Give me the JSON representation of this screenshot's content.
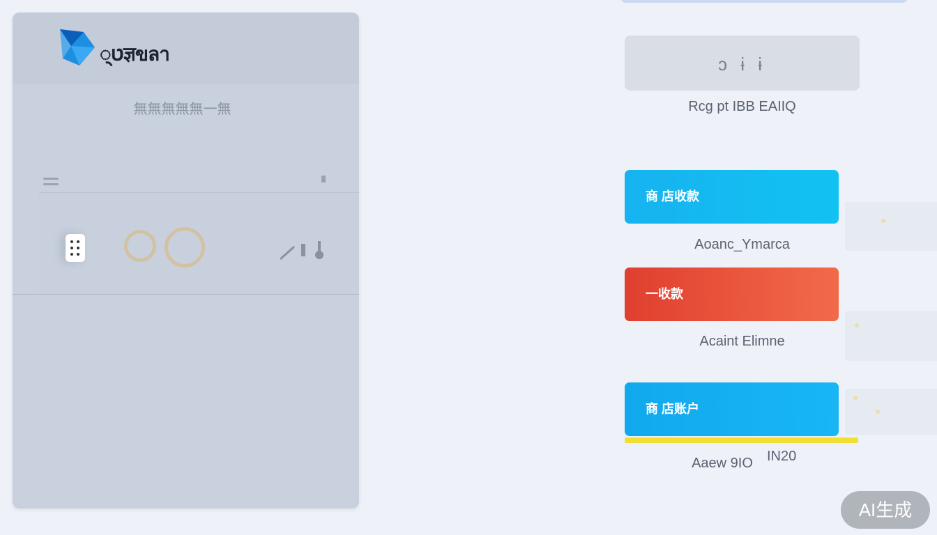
{
  "header": {
    "brand_name": "ט्ज्ञขลา",
    "subtitle": "無無無無無一無"
  },
  "display": {
    "value": "ɔ ɨ ɨ"
  },
  "captions": {
    "under_display": "Rcg pt IBB EAIIQ",
    "under_button_1": "Aoanc_Ymarca",
    "under_button_2": "Acaint Elimne",
    "under_button_3": "Aaew 9IO",
    "extra_value": "IN20"
  },
  "buttons": {
    "btn1_label": "商 店收款",
    "btn2_label": "一收款",
    "btn3_label": "商 店账户"
  },
  "badge": {
    "label": "AI生成"
  },
  "colors": {
    "accent_blue": "#16b3f0",
    "accent_red": "#e03f2f",
    "highlight_yellow": "#f3df34"
  },
  "icons": [
    "brand-logo-icon",
    "hamburger-icon",
    "knob-icon",
    "coin-icon",
    "signal-icon"
  ]
}
